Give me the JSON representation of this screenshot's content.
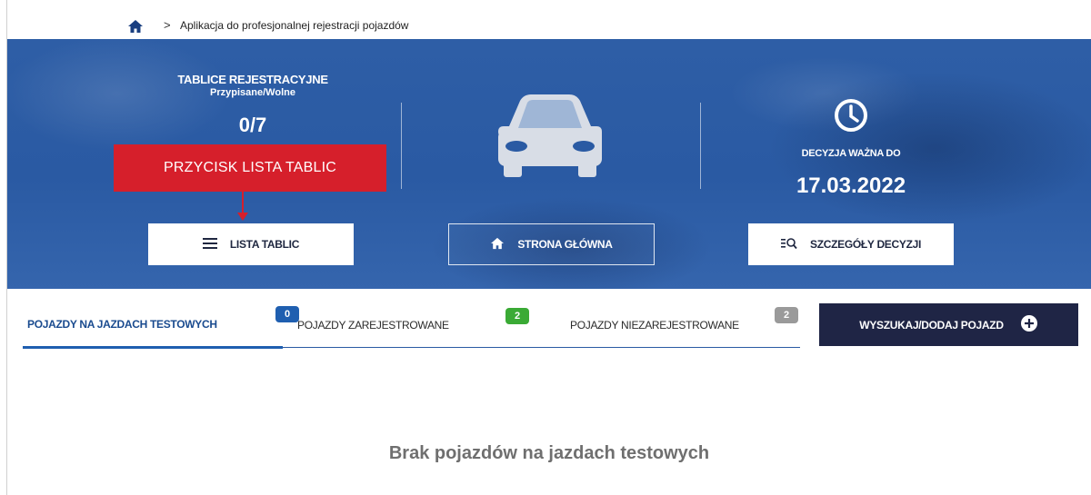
{
  "breadcrumb": {
    "home_icon": "home-icon",
    "separator": ">",
    "current": "Aplikacja do profesjonalnej rejestracji pojazdów"
  },
  "hero": {
    "plates": {
      "title": "TABLICE REJESTRACYJNE",
      "subtitle": "Przypisane/Wolne",
      "value": "0/7"
    },
    "center_icon": "car-icon",
    "decision": {
      "icon": "clock-icon",
      "title": "DECYZJA WAŻNA DO",
      "value": "17.03.2022"
    },
    "annotation": "PRZYCISK LISTA TABLIC",
    "buttons": {
      "list_plates": "LISTA TABLIC",
      "home": "STRONA GŁÓWNA",
      "decision_details": "SZCZEGÓŁY DECYZJI"
    }
  },
  "tabs": [
    {
      "label": "POJAZDY NA JAZDACH TESTOWYCH",
      "count": "0",
      "color": "#1f5fb0",
      "active": true
    },
    {
      "label": "POJAZDY ZAREJESTROWANE",
      "count": "2",
      "color": "#3aaa35",
      "active": false
    },
    {
      "label": "POJAZDY NIEZAREJESTROWANE",
      "count": "2",
      "color": "#9a9a9a",
      "active": false
    }
  ],
  "actions": {
    "search_add": "WYSZUKAJ/DODAJ POJAZD"
  },
  "empty_state": {
    "message": "Brak pojazdów na jazdach testowych"
  },
  "colors": {
    "hero_blue": "#2e5ea6",
    "annotation_red": "#d61f2b",
    "navy": "#1f2545"
  }
}
